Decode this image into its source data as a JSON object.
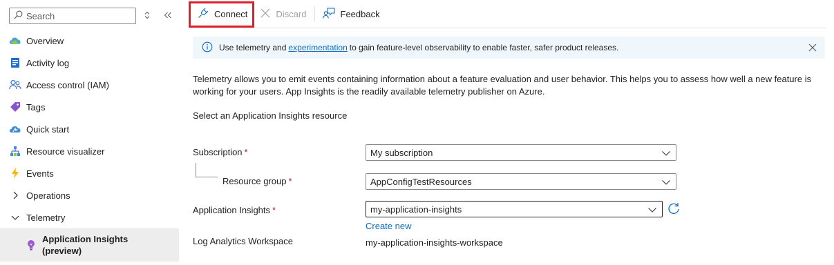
{
  "sidebar": {
    "search_placeholder": "Search",
    "items": [
      {
        "label": "Overview",
        "icon": "overview-cloud-icon"
      },
      {
        "label": "Activity log",
        "icon": "activity-log-icon"
      },
      {
        "label": "Access control (IAM)",
        "icon": "people-icon"
      },
      {
        "label": "Tags",
        "icon": "tag-icon"
      },
      {
        "label": "Quick start",
        "icon": "quick-start-cloud-icon"
      },
      {
        "label": "Resource visualizer",
        "icon": "hierarchy-icon"
      },
      {
        "label": "Events",
        "icon": "lightning-icon"
      },
      {
        "label": "Operations",
        "icon": "chevron-right-icon"
      },
      {
        "label": "Telemetry",
        "icon": "chevron-down-icon"
      }
    ],
    "selected_sub_item": {
      "label_line1": "Application Insights",
      "label_line2": "(preview)",
      "icon": "lightbulb-icon"
    }
  },
  "toolbar": {
    "connect_label": "Connect",
    "discard_label": "Discard",
    "feedback_label": "Feedback"
  },
  "info_bar": {
    "text_before": "Use telemetry and",
    "link_text": "experimentation",
    "text_after": "to gain feature-level observability to enable faster, safer product releases."
  },
  "description": "Telemetry allows you to emit events containing information about a feature evaluation and user behavior. This helps you to assess how well a new feature is working for your users. App Insights is the readily available telemetry publisher on Azure.",
  "section_label": "Select an Application Insights resource",
  "form": {
    "subscription_label": "Subscription",
    "subscription_value": "My subscription",
    "resource_group_label": "Resource group",
    "resource_group_value": "AppConfigTestResources",
    "app_insights_label": "Application Insights",
    "app_insights_value": "my-application-insights",
    "create_new_label": "Create new",
    "workspace_label": "Log Analytics Workspace",
    "workspace_value": "my-application-insights-workspace",
    "required_marker": "*"
  },
  "colors": {
    "accent": "#0f6cbd",
    "highlight_border": "#e01e2b",
    "info_bg": "#eff6fc",
    "selected_bg": "#ededed"
  }
}
